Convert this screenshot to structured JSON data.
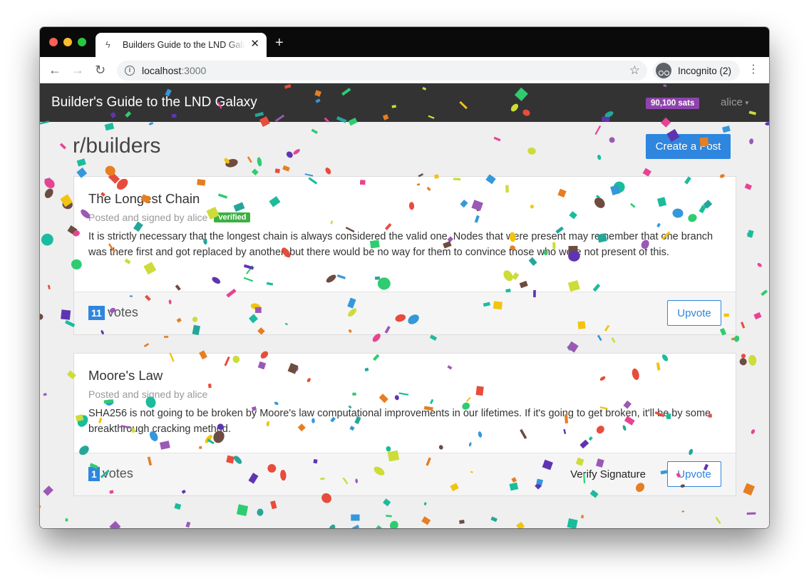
{
  "browser": {
    "tab_title": "Builders Guide to the LND Galaxy",
    "tab_close": "✕",
    "new_tab": "+",
    "url_host": "localhost",
    "url_port": ":3000",
    "profile_label": "Incognito (2)",
    "icons": [
      "back-arrow-icon",
      "forward-arrow-icon",
      "reload-icon",
      "info-icon",
      "star-icon",
      "incognito-icon",
      "kebab-menu-icon",
      "lightning-icon"
    ]
  },
  "navbar": {
    "brand": "Builder's Guide to the LND Galaxy",
    "balance": "90,100 sats",
    "user": "alice"
  },
  "page": {
    "title": "r/builders",
    "create_label": "Create a Post"
  },
  "posts": [
    {
      "title": "The Longest Chain",
      "meta": "Posted and signed by alice",
      "badge": "verified",
      "body": "It is strictly necessary that the longest chain is always considered the valid one. Nodes that were present may remember that one branch was there first and got replaced by another, but there would be no way for them to convince those who were not present of this.",
      "votes": "11",
      "votes_label": "votes",
      "upvote_label": "Upvote"
    },
    {
      "title": "Moore's Law",
      "meta": "Posted and signed by alice",
      "body": "SHA256 is not going to be broken by Moore's law computational improvements in our lifetimes. If it's going to get broken, it'll be by some breakthrough cracking method.",
      "votes": "1",
      "votes_label": "votes",
      "verify_label": "Verify Signature",
      "upvote_label": "Upvote"
    }
  ],
  "colors": {
    "navbar_bg": "#333333",
    "primary": "#2e86de",
    "verified": "#3cb043",
    "balance_badge": "#8e44ad",
    "confetti": [
      "#e74c3c",
      "#f1c40f",
      "#2ecc71",
      "#3498db",
      "#9b59b6",
      "#e67e22",
      "#1abc9c",
      "#e84393",
      "#6d4c41",
      "#cddc39",
      "#5e35b1",
      "#26a69a"
    ]
  }
}
